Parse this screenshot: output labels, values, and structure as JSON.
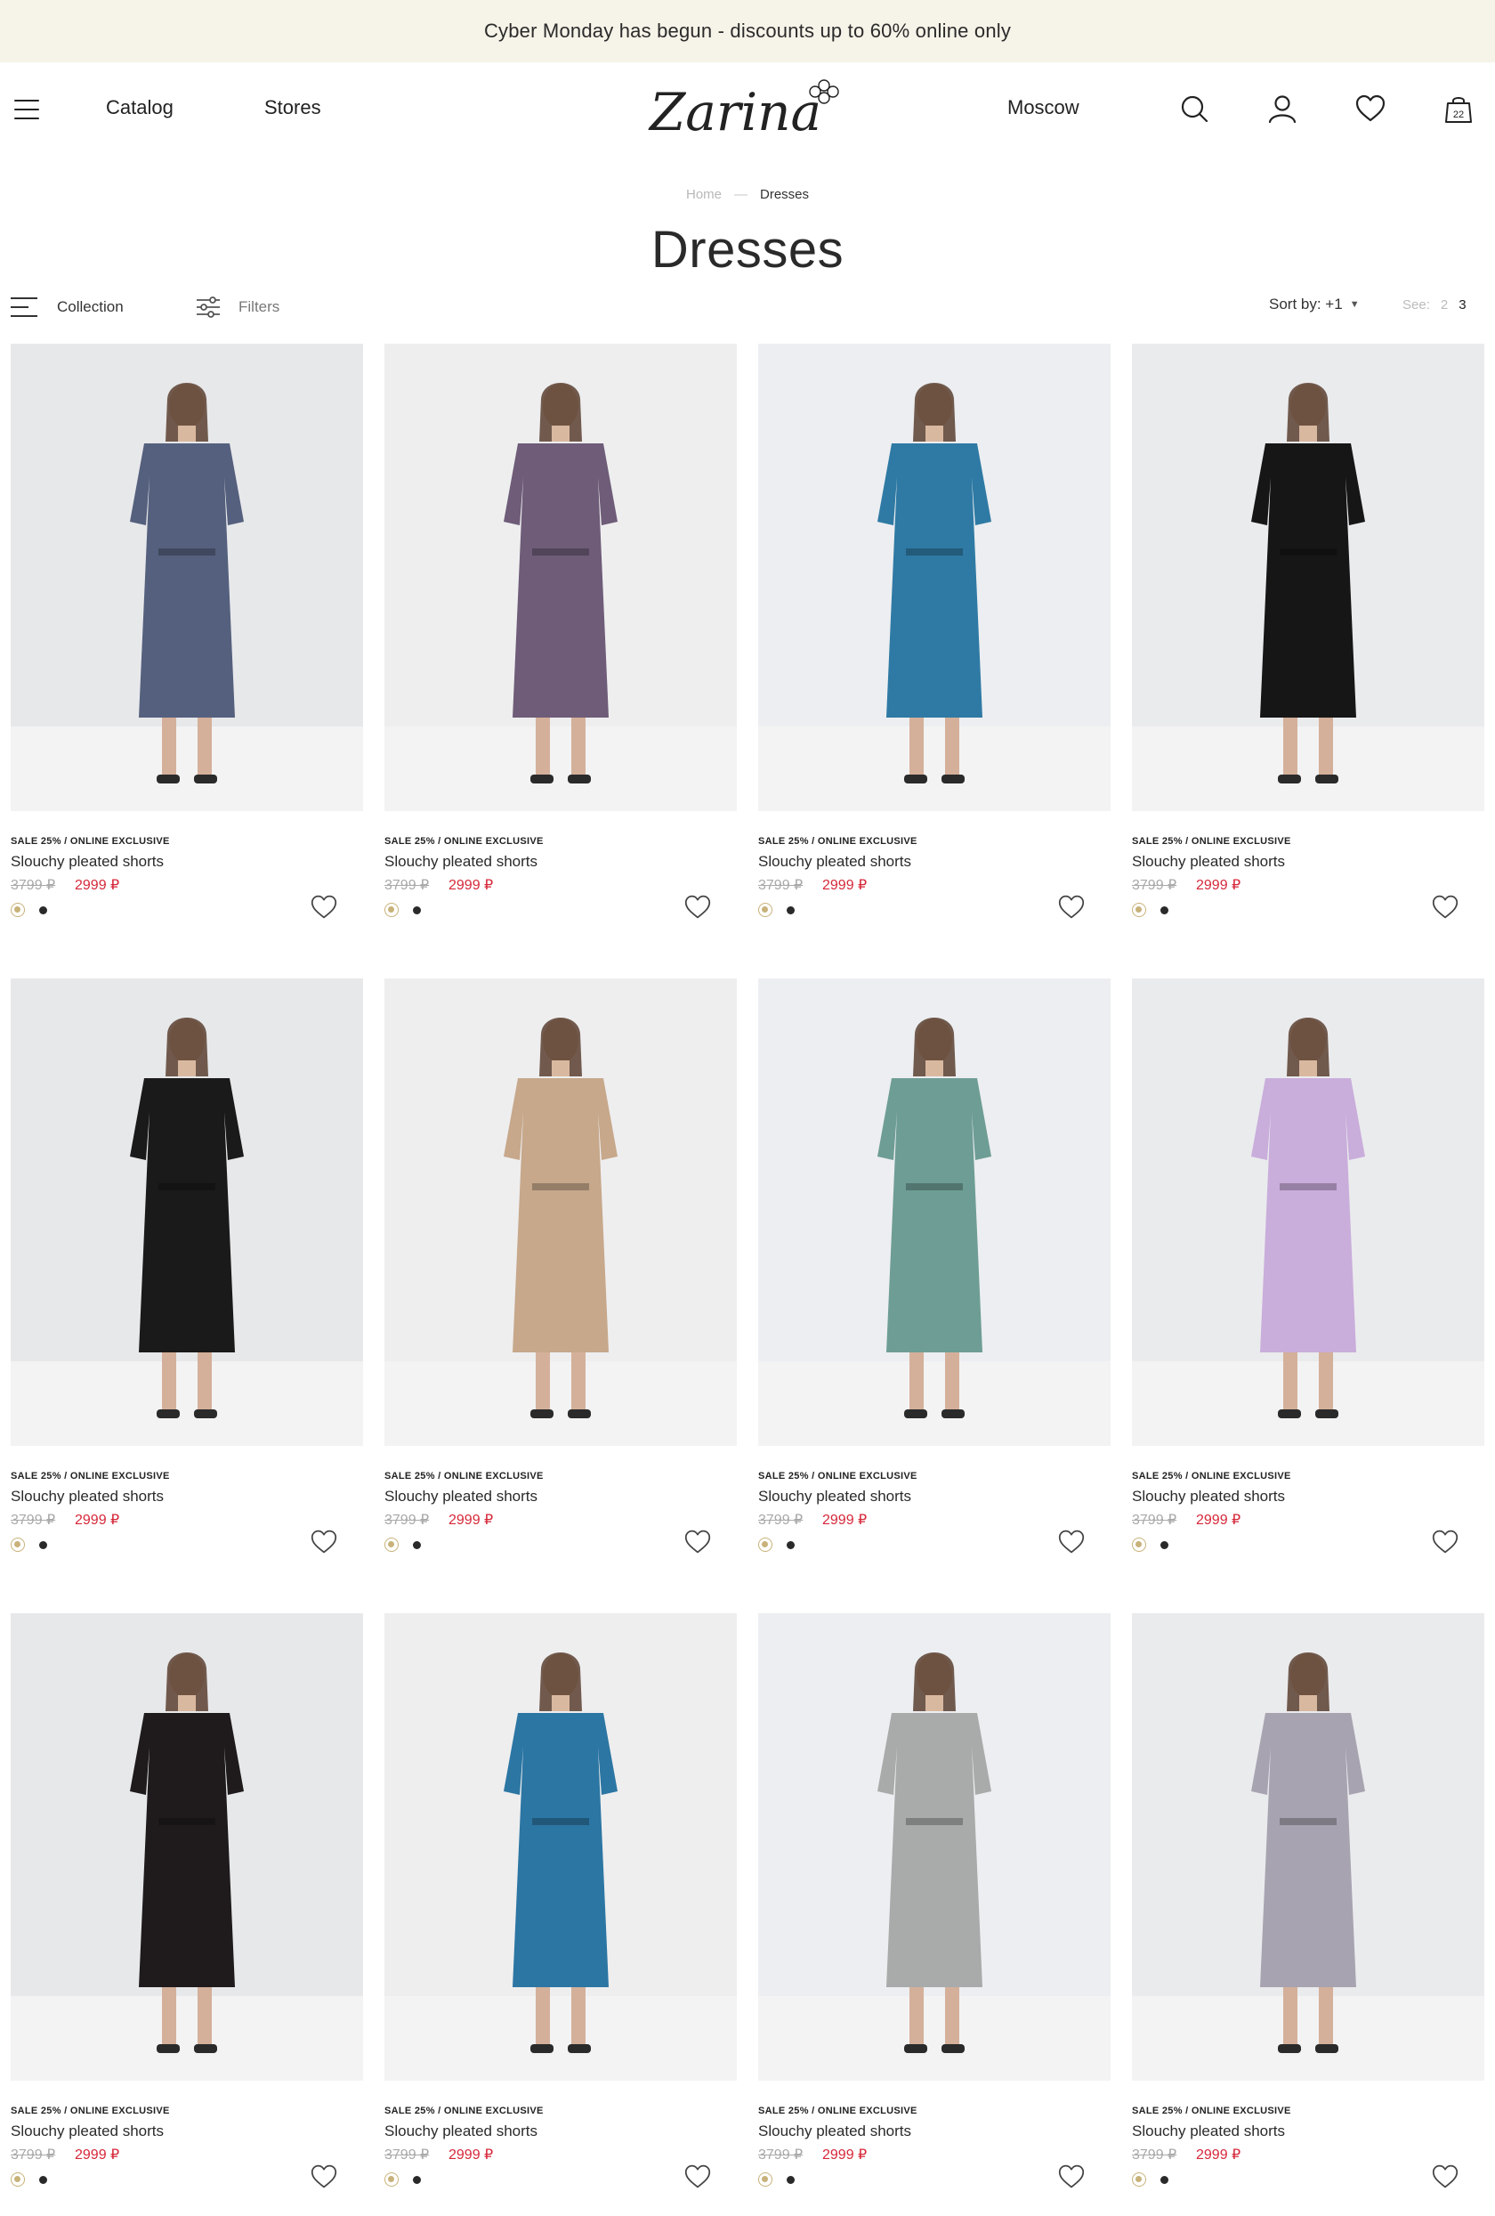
{
  "promo": {
    "text": "Cyber Monday has begun - discounts up to 60% online only",
    "bg": "#f6f3e8"
  },
  "header": {
    "menu_icon": "hamburger-icon",
    "nav": [
      "Catalog",
      "Stores"
    ],
    "logo_text": "Zarina",
    "city": "Moscow",
    "icons": [
      "search-icon",
      "user-icon",
      "heart-icon",
      "cart-icon"
    ],
    "cart_count": "22"
  },
  "breadcrumb": {
    "home": "Home",
    "separator": "—",
    "current": "Dresses"
  },
  "page_title": "Dresses",
  "toolbar": {
    "collection_label": "Collection",
    "filters_label": "Filters",
    "sort_label": "Sort by: +1",
    "see_label": "See:",
    "see_options": [
      "2",
      "3"
    ],
    "see_active": "3"
  },
  "colors": {
    "sale_price": "#d6283a",
    "old_price": "#a9a9a9",
    "swatch_gold": "#c8b27a",
    "swatch_dark": "#2a2a2a"
  },
  "products": [
    {
      "badge": "SALE 25% / ONLINE EXCLUSIVE",
      "name": "Slouchy pleated shorts",
      "old_price": "3799 ₽",
      "new_price": "2999 ₽",
      "dress_color": "#55607e"
    },
    {
      "badge": "SALE 25% / ONLINE EXCLUSIVE",
      "name": "Slouchy pleated shorts",
      "old_price": "3799 ₽",
      "new_price": "2999 ₽",
      "dress_color": "#6e5c78"
    },
    {
      "badge": "SALE 25% / ONLINE EXCLUSIVE",
      "name": "Slouchy pleated shorts",
      "old_price": "3799 ₽",
      "new_price": "2999 ₽",
      "dress_color": "#2f7aa4"
    },
    {
      "badge": "SALE 25% / ONLINE EXCLUSIVE",
      "name": "Slouchy pleated shorts",
      "old_price": "3799 ₽",
      "new_price": "2999 ₽",
      "dress_color": "#161616"
    },
    {
      "badge": "SALE 25% / ONLINE EXCLUSIVE",
      "name": "Slouchy pleated shorts",
      "old_price": "3799 ₽",
      "new_price": "2999 ₽",
      "dress_color": "#1a1a1a"
    },
    {
      "badge": "SALE 25% / ONLINE EXCLUSIVE",
      "name": "Slouchy pleated shorts",
      "old_price": "3799 ₽",
      "new_price": "2999 ₽",
      "dress_color": "#c7a88b"
    },
    {
      "badge": "SALE 25% / ONLINE EXCLUSIVE",
      "name": "Slouchy pleated shorts",
      "old_price": "3799 ₽",
      "new_price": "2999 ₽",
      "dress_color": "#6e9d95"
    },
    {
      "badge": "SALE 25% / ONLINE EXCLUSIVE",
      "name": "Slouchy pleated shorts",
      "old_price": "3799 ₽",
      "new_price": "2999 ₽",
      "dress_color": "#c9addb"
    },
    {
      "badge": "SALE 25% / ONLINE EXCLUSIVE",
      "name": "Slouchy pleated shorts",
      "old_price": "3799 ₽",
      "new_price": "2999 ₽",
      "dress_color": "#1f1b1c"
    },
    {
      "badge": "SALE 25% / ONLINE EXCLUSIVE",
      "name": "Slouchy pleated shorts",
      "old_price": "3799 ₽",
      "new_price": "2999 ₽",
      "dress_color": "#2c76a3"
    },
    {
      "badge": "SALE 25% / ONLINE EXCLUSIVE",
      "name": "Slouchy pleated shorts",
      "old_price": "3799 ₽",
      "new_price": "2999 ₽",
      "dress_color": "#a9abaa"
    },
    {
      "badge": "SALE 25% / ONLINE EXCLUSIVE",
      "name": "Slouchy pleated shorts",
      "old_price": "3799 ₽",
      "new_price": "2999 ₽",
      "dress_color": "#a8a3b1"
    }
  ]
}
